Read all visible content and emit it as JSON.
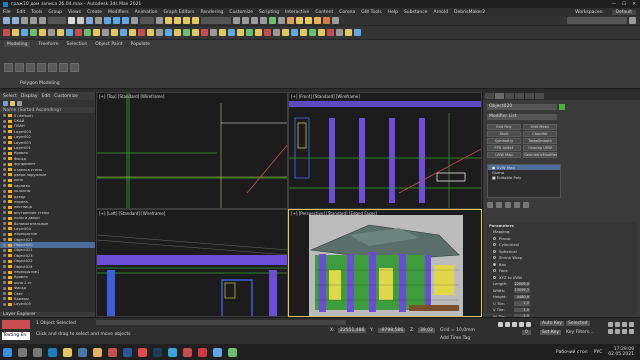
{
  "window": {
    "title": "граж10 дом записа 26.04.max - Autodesk 3ds Max 2021",
    "controls": [
      "—",
      "☐",
      "✕"
    ]
  },
  "menu": {
    "items": [
      "File",
      "Edit",
      "Tools",
      "Group",
      "Views",
      "Create",
      "Modifiers",
      "Animation",
      "Graph Editors",
      "Rendering",
      "Customize",
      "Scripting",
      "Interactive",
      "Content",
      "Corona",
      "GW Tools",
      "Help",
      "Substance",
      "Arnold",
      "DebrisMaker2"
    ],
    "workspace_label": "Workspaces:",
    "workspace_value": "Default"
  },
  "ribbon": {
    "tabs": [
      "Modeling",
      "Freeform",
      "Selection",
      "Object Paint",
      "Populate"
    ],
    "active_tab": "Modeling",
    "sub_label": "Polygon Modeling"
  },
  "scene_explorer": {
    "tabs": [
      "Select",
      "Display",
      "Edit",
      "Customize"
    ],
    "header": "Name (Sorted Ascending)",
    "rows": [
      {
        "name": "0 (default)",
        "sel": false
      },
      {
        "name": "СКАЙ",
        "sel": false
      },
      {
        "name": "ПЛАН",
        "sel": false
      },
      {
        "name": "Layer003",
        "sel": false
      },
      {
        "name": "Layer002",
        "sel": false
      },
      {
        "name": "Layer003",
        "sel": false
      },
      {
        "name": "Layer001",
        "sel": false
      },
      {
        "name": "Кровля",
        "sel": false
      },
      {
        "name": "Фасад",
        "sel": false
      },
      {
        "name": "фундамент",
        "sel": false
      },
      {
        "name": "отделка стены",
        "sel": false
      },
      {
        "name": "двери наружные",
        "sel": false
      },
      {
        "name": "окна",
        "sel": false
      },
      {
        "name": "карнизы",
        "sel": false
      },
      {
        "name": "колонны",
        "sel": false
      },
      {
        "name": "декор",
        "sel": false
      },
      {
        "name": "перила",
        "sel": false
      },
      {
        "name": "лестница",
        "sel": false
      },
      {
        "name": "внутренние стены",
        "sel": false
      },
      {
        "name": "полы и двери",
        "sel": false
      },
      {
        "name": "Вспомогательные",
        "sel": false
      },
      {
        "name": "Layer004",
        "sel": false
      },
      {
        "name": "перекрытие",
        "sel": false
      },
      {
        "name": "Object021",
        "sel": false
      },
      {
        "name": "Object020",
        "sel": true
      },
      {
        "name": "Object021",
        "sel": false
      },
      {
        "name": "Object023",
        "sel": false
      },
      {
        "name": "Object022",
        "sel": false
      },
      {
        "name": "Object024",
        "sel": false
      },
      {
        "name": "перекрытие1",
        "sel": false
      },
      {
        "name": "Кровля",
        "sel": false
      },
      {
        "name": "окна 2 эт",
        "sel": false
      },
      {
        "name": "Фасад",
        "sel": false
      },
      {
        "name": "Свет",
        "sel": false
      },
      {
        "name": "Камеры",
        "sel": false
      },
      {
        "name": "Layer005",
        "sel": false
      }
    ],
    "footer_tabs": [
      "Layer Explorer"
    ]
  },
  "viewports": {
    "top": "[+] [Top] [Standard] [Wireframe]",
    "front": "[+] [Front] [Standard] [Wireframe]",
    "left": "[+] [Left] [Standard] [Wireframe]",
    "persp": "[+] [Perspective] [Standard] [Edged Faces]"
  },
  "command_panel": {
    "object_name": "Object020",
    "modifier_list": "Modifier List",
    "buttons": [
      "Edit Poly",
      "Edit Mesh",
      "Shell",
      "Chamfer",
      "Symmetry",
      "TurboSmooth",
      "FFD 4x4x4",
      "Unwrap UVW",
      "UVW Map",
      "GeometricModifier"
    ],
    "stack": [
      {
        "label": "● UVW Map",
        "sel": true
      },
      {
        "label": "   Gizmo",
        "sel": false
      },
      {
        "label": "■ Editable Poly",
        "sel": false
      }
    ],
    "params_title": "Parameters",
    "mapping_label": "Mapping:",
    "mapping_options": [
      {
        "label": "Planar",
        "on": false
      },
      {
        "label": "Cylindrical",
        "on": false
      },
      {
        "label": "Spherical",
        "on": false
      },
      {
        "label": "Shrink Wrap",
        "on": false
      },
      {
        "label": "Box",
        "on": true
      },
      {
        "label": "Face",
        "on": false
      },
      {
        "label": "XYZ to UVW",
        "on": false
      }
    ],
    "dims": [
      {
        "label": "Length:",
        "value": "22009,0"
      },
      {
        "label": "Width:",
        "value": "13099,3"
      },
      {
        "label": "Height:",
        "value": "4480,9"
      },
      {
        "label": "U Tile:",
        "value": "1,0"
      },
      {
        "label": "V Tile:",
        "value": "1,0"
      },
      {
        "label": "W Tile:",
        "value": "1,0"
      }
    ],
    "flip": "Flip"
  },
  "status": {
    "selection": "1 Object Selected",
    "hint": "Click and drag to select and move objects",
    "maxscript": "Texting En",
    "coords": {
      "x": "22551,486",
      "y": "-9798,586",
      "z": "39,02"
    },
    "grid": "Grid = 10,0mm",
    "add_time_tag": "Add Time Tag",
    "auto_key": "Auto Key",
    "selected": "Selected",
    "set_key": "Set Key",
    "key_filters": "Key Filters...",
    "frame": "0"
  },
  "taskbar": {
    "lang": "РУС",
    "time": "17:29:09",
    "date": "02.05.2021",
    "weather": "Рабочий стол"
  },
  "colors": {
    "accent": "#4a6d9a",
    "persp_bg": "#bcbcbc",
    "wall_purple": "#6b4dd6",
    "wire_green": "#2fa52a",
    "wire_blue": "#3a5fd9",
    "obj_color": "#41b431"
  }
}
